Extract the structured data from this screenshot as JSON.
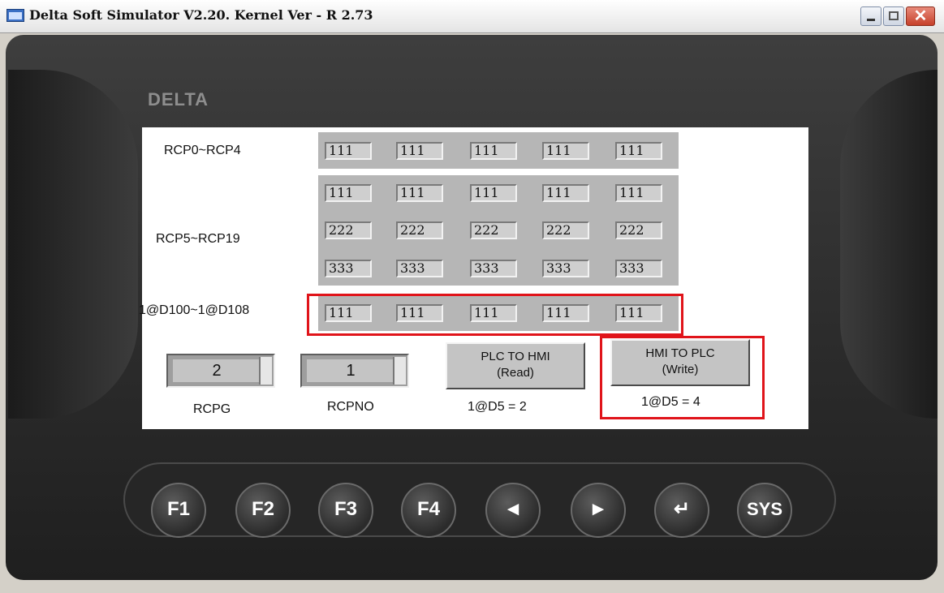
{
  "window": {
    "title": "Delta Soft Simulator V2.20. Kernel Ver - R 2.73",
    "close_glyph": "✕"
  },
  "device": {
    "logo": "DELTA"
  },
  "screen": {
    "rows": [
      {
        "label": "RCP0~RCP4",
        "values": [
          "111",
          "111",
          "111",
          "111",
          "111"
        ]
      },
      {
        "label": "RCP5~RCP19",
        "values": [
          [
            "111",
            "111",
            "111",
            "111",
            "111"
          ],
          [
            "222",
            "222",
            "222",
            "222",
            "222"
          ],
          [
            "333",
            "333",
            "333",
            "333",
            "333"
          ]
        ]
      },
      {
        "label": "1@D100~1@D108",
        "values": [
          "111",
          "111",
          "111",
          "111",
          "111"
        ]
      }
    ],
    "rcpg": {
      "value": "2",
      "label": "RCPG"
    },
    "rcpno": {
      "value": "1",
      "label": "RCPNO"
    },
    "read_button": {
      "line1": "PLC TO HMI",
      "line2": "(Read)",
      "caption": "1@D5 = 2"
    },
    "write_button": {
      "line1": "HMI TO PLC",
      "line2": "(Write)",
      "caption": "1@D5 = 4"
    }
  },
  "keys": [
    "F1",
    "F2",
    "F3",
    "F4",
    "◄",
    "►",
    "↵",
    "SYS"
  ],
  "colors": {
    "highlight": "#e0141a",
    "led": "#e8e232"
  }
}
